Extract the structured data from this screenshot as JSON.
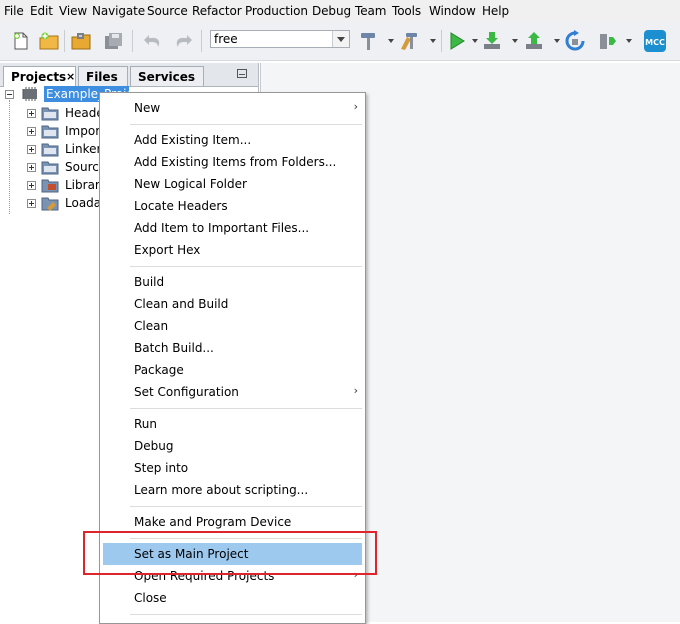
{
  "menubar": {
    "items": [
      "File",
      "Edit",
      "View",
      "Navigate",
      "Source",
      "Refactor",
      "Production",
      "Debug",
      "Team",
      "Tools",
      "Window",
      "Help"
    ]
  },
  "toolbar": {
    "configuration_value": "free",
    "mcc_label": "MCC",
    "icons": [
      "new-file-icon",
      "new-project-icon",
      "open-project-icon",
      "save-all-icon",
      "undo-icon",
      "redo-icon",
      "build-hammer-icon",
      "clean-build-icon",
      "run-icon",
      "program-device-icon",
      "read-device-icon",
      "reset-refresh-icon",
      "hold-in-reset-icon",
      "mcc-icon"
    ]
  },
  "panel": {
    "tabs": [
      "Projects",
      "Files",
      "Services"
    ],
    "close_glyph": "×",
    "project_name": "Example_Project",
    "tree_items": [
      "Header",
      "Import",
      "Linker F",
      "Source",
      "Librarie",
      "Loadab"
    ]
  },
  "context_menu": {
    "groups": [
      [
        {
          "label": "New",
          "submenu": true
        }
      ],
      [
        {
          "label": "Add Existing Item..."
        },
        {
          "label": "Add Existing Items from Folders..."
        },
        {
          "label": "New Logical Folder"
        },
        {
          "label": "Locate Headers"
        },
        {
          "label": "Add Item to Important Files..."
        },
        {
          "label": "Export Hex"
        }
      ],
      [
        {
          "label": "Build"
        },
        {
          "label": "Clean and Build"
        },
        {
          "label": "Clean"
        },
        {
          "label": "Batch Build..."
        },
        {
          "label": "Package"
        },
        {
          "label": "Set Configuration",
          "submenu": true
        }
      ],
      [
        {
          "label": "Run"
        },
        {
          "label": "Debug"
        },
        {
          "label": "Step into"
        },
        {
          "label": "Learn more about scripting..."
        }
      ],
      [
        {
          "label": "Make and Program Device"
        }
      ],
      [
        {
          "label": "Set as Main Project",
          "highlighted": true
        },
        {
          "label": "Open Required Projects",
          "submenu": true
        },
        {
          "label": "Close"
        }
      ]
    ],
    "submenu_glyph": "›"
  },
  "colors": {
    "highlight": "#9ec9ef",
    "selection": "#3d8ee0",
    "annotation_box": "#e0242b"
  }
}
